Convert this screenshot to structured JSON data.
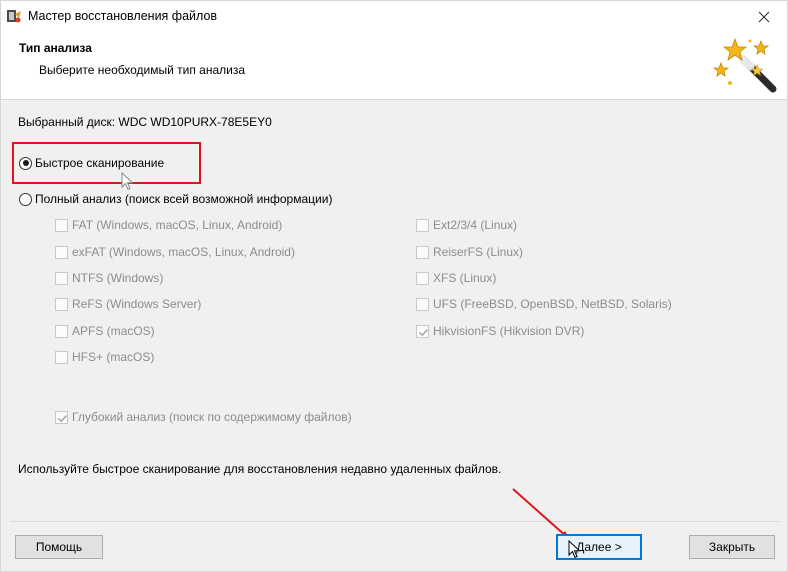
{
  "window": {
    "title": "Мастер восстановления файлов",
    "app_icon": "app-icon",
    "close_icon": "close-icon"
  },
  "header": {
    "title": "Тип анализа",
    "subtitle": "Выберите необходимый тип анализа",
    "image_icon": "magic-wand-icon"
  },
  "disk": {
    "label": "Выбранный диск: WDC WD10PURX-78E5EY0"
  },
  "scan_options": {
    "fast": {
      "label": "Быстрое сканирование",
      "checked": true
    },
    "full": {
      "label": "Полный анализ (поиск всей возможной информации)",
      "checked": false
    }
  },
  "filesystems_left": [
    {
      "label": "FAT (Windows, macOS, Linux, Android)",
      "checked": false
    },
    {
      "label": "exFAT (Windows, macOS, Linux, Android)",
      "checked": false
    },
    {
      "label": "NTFS (Windows)",
      "checked": false
    },
    {
      "label": "ReFS (Windows Server)",
      "checked": false
    },
    {
      "label": "APFS (macOS)",
      "checked": false
    },
    {
      "label": "HFS+ (macOS)",
      "checked": false
    }
  ],
  "filesystems_right": [
    {
      "label": "Ext2/3/4 (Linux)",
      "checked": false
    },
    {
      "label": "ReiserFS (Linux)",
      "checked": false
    },
    {
      "label": "XFS (Linux)",
      "checked": false
    },
    {
      "label": "UFS (FreeBSD, OpenBSD, NetBSD, Solaris)",
      "checked": false
    },
    {
      "label": "HikvisionFS (Hikvision DVR)",
      "checked": true
    }
  ],
  "deep_analysis": {
    "label": "Глубокий анализ (поиск по содержимому файлов)",
    "checked": true
  },
  "hint": "Используйте быстрое сканирование для восстановления недавно удаленных файлов.",
  "buttons": {
    "help": "Помощь",
    "next": "Далее >",
    "close": "Закрыть"
  },
  "colors": {
    "highlight": "#e0141e",
    "accent": "#0078d7"
  }
}
